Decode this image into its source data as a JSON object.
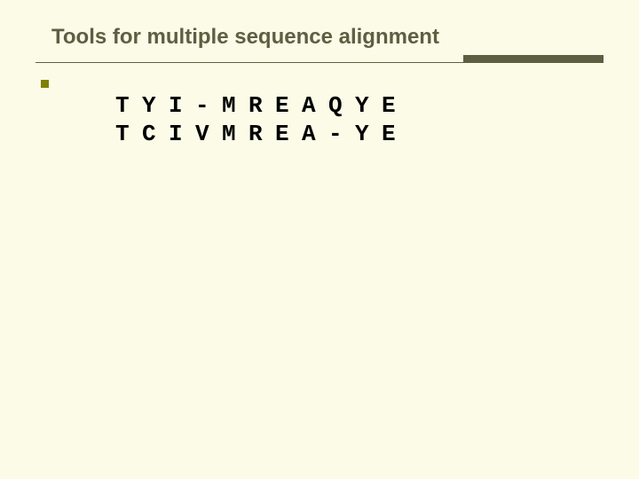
{
  "title": "Tools for multiple sequence alignment",
  "sequences": {
    "row1": [
      "T",
      "Y",
      "I",
      "-",
      "M",
      "R",
      "E",
      "A",
      "Q",
      "Y",
      "E"
    ],
    "row2": [
      "T",
      "C",
      "I",
      "V",
      "M",
      "R",
      "E",
      "A",
      "-",
      "Y",
      "E"
    ]
  }
}
